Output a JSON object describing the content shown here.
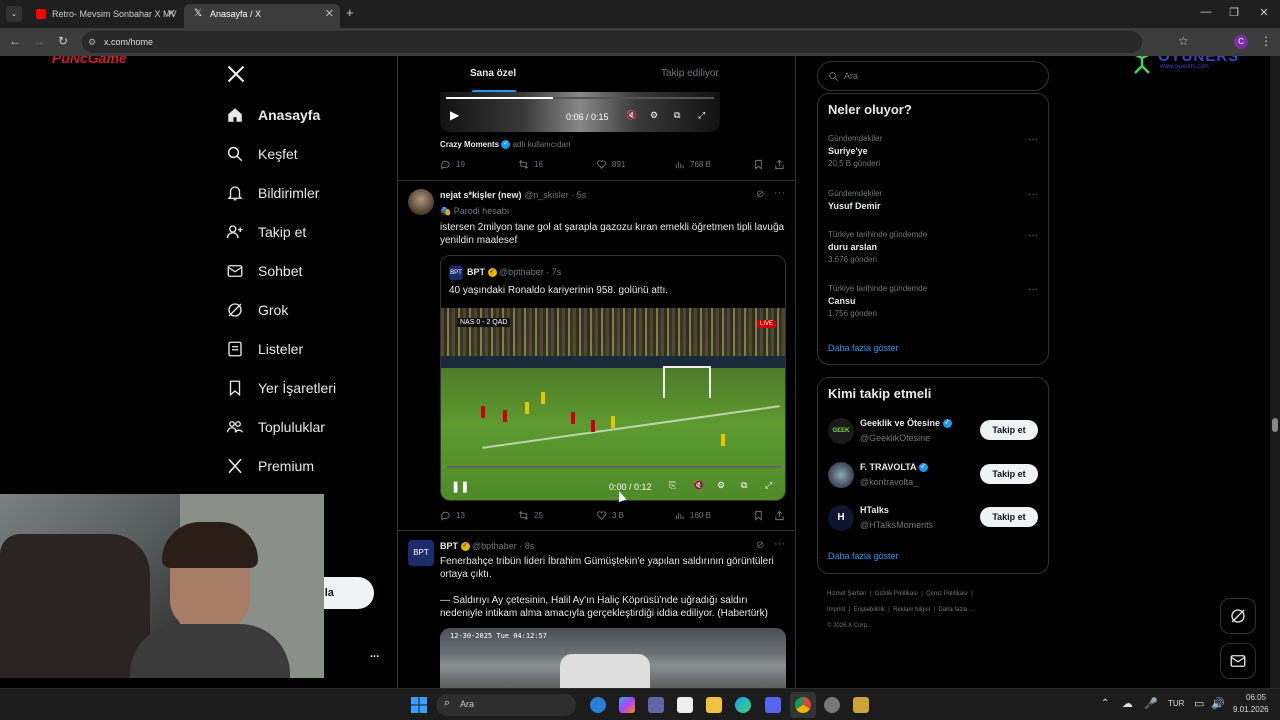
{
  "browser": {
    "tabs": [
      {
        "title": "Retro- Mevsim Sonbahar X MV"
      },
      {
        "title": "Anasayfa / X"
      }
    ],
    "url": "x.com/home",
    "avatar_letter": "C"
  },
  "overlay": {
    "logo_left": "PuNcGame",
    "logo_right": "OYUNERS",
    "logo_right_sub": "www.oyuners.com"
  },
  "sidebar": {
    "items": [
      {
        "label": "Anasayfa",
        "icon": "home-icon"
      },
      {
        "label": "Keşfet",
        "icon": "search-icon"
      },
      {
        "label": "Bildirimler",
        "icon": "bell-icon"
      },
      {
        "label": "Takip et",
        "icon": "follow-icon"
      },
      {
        "label": "Sohbet",
        "icon": "mail-icon"
      },
      {
        "label": "Grok",
        "icon": "grok-icon"
      },
      {
        "label": "Listeler",
        "icon": "list-icon"
      },
      {
        "label": "Yer İşaretleri",
        "icon": "bookmark-icon"
      },
      {
        "label": "Topluluklar",
        "icon": "communities-icon"
      },
      {
        "label": "Premium",
        "icon": "x-icon"
      }
    ],
    "post_button_partial": "nla",
    "more": "..."
  },
  "feed": {
    "tabs": [
      "Sana özel",
      "Takip ediliyor"
    ],
    "top_tweet": {
      "video_time": "0:06 / 0:15",
      "source_name": "Crazy Moments",
      "source_suffix": "adlı kullanıcıdan",
      "replies": "19",
      "reposts": "16",
      "likes": "891",
      "views": "768 B"
    },
    "tweet1": {
      "name": "nejat s*kişler (new)",
      "handle": "@n_skisler",
      "time": "5s",
      "badge": "Parodi hesabı",
      "text": "istersen 2milyon tane gol at şarapla gazozu kıran emekli öğretmen tipli lavuğa yenildin maalesef",
      "quote": {
        "name": "BPT",
        "handle": "@bpthaber",
        "time": "7s",
        "text": "40 yaşındaki Ronaldo kariyerinin 958. golünü attı.",
        "video_time": "0:00 / 0:12",
        "score": "NAS 0 - 2 QAD"
      },
      "replies": "13",
      "reposts": "25",
      "likes": "3 B",
      "views": "160 B"
    },
    "tweet2": {
      "name": "BPT",
      "handle": "@bpthaber",
      "time": "8s",
      "text1": "Fenerbahçe tribün lideri İbrahim Gümüştekin'e yapılan saldırının görüntüleri ortaya çıktı.",
      "text2": "— Saldırıyı Ay çetesinin, Halil Ay'ın Haliç Köprüsü'nde uğradığı saldırı nedeniyle intikam alma amacıyla gerçekleştirdiği iddia ediliyor. (Habertürk)",
      "cctv_stamp": "12-30-2025 Tue 04:12:57"
    }
  },
  "right": {
    "search_placeholder": "Ara",
    "trends_title": "Neler oluyor?",
    "trends": [
      {
        "category": "Gündemdekiler",
        "title": "Suriye'ye",
        "count": "20,5 B gönderi"
      },
      {
        "category": "Gündemdekiler",
        "title": "Yusuf Demir",
        "count": ""
      },
      {
        "category": "Türkiye tarihinde gündemde",
        "title": "duru arslan",
        "count": "3.676 gönderi"
      },
      {
        "category": "Türkiye tarihinde gündemde",
        "title": "Cansu",
        "count": "1.756 gönderi"
      }
    ],
    "show_more": "Daha fazla göster",
    "who_title": "Kimi takip etmeli",
    "who": [
      {
        "name": "Geeklik ve Ötesine",
        "handle": "@GeeklikOtesine",
        "button": "Takip et"
      },
      {
        "name": "F. TRAVOLTA",
        "handle": "@kontravolta_",
        "button": "Takip et"
      },
      {
        "name": "HTalks",
        "handle": "@HTalksMoments",
        "button": "Takip et"
      }
    ],
    "who_more": "Daha fazla göster",
    "footer_line1": [
      "Hizmet Şartları",
      "Gizlilik Politikası",
      "Çerez Politikası"
    ],
    "footer_line2": [
      "Imprint",
      "Erişilebilirlik",
      "Reklam bilgisi",
      "Daha fazla ..."
    ],
    "copyright": "© 2026 X Corp."
  },
  "taskbar": {
    "search_placeholder": "Ara",
    "lang": "TUR",
    "time": "06:05",
    "date": "9.01.2026"
  }
}
